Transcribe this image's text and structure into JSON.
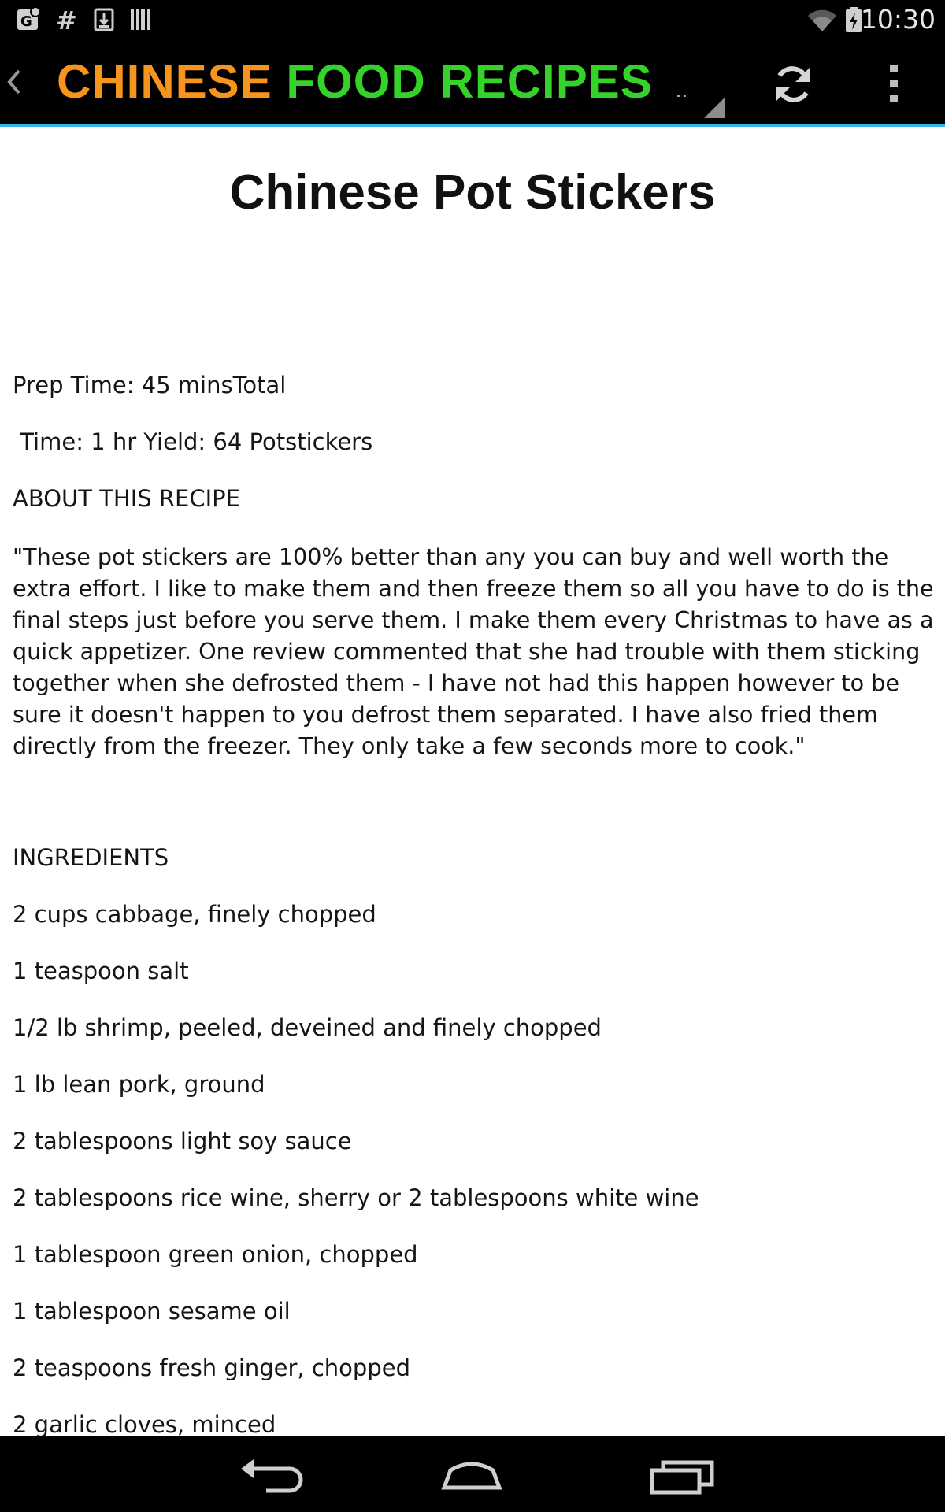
{
  "status_bar": {
    "time": "10:30",
    "icons": [
      "maps-notification-icon",
      "hashtag-notification-icon",
      "download-notification-icon",
      "barcode-notification-icon",
      "wifi-icon",
      "battery-charging-icon"
    ]
  },
  "action_bar": {
    "brand_word1": "CHINESE",
    "brand_word2": "FOOD RECIPES",
    "spinner_text": "..",
    "brand_colors": {
      "word1": "#f7941d",
      "word2": "#35d22a"
    },
    "accent": "#33b5e5",
    "icons": [
      "back-caret-icon",
      "refresh-icon",
      "overflow-menu-icon"
    ]
  },
  "recipe": {
    "title": "Chinese Pot Stickers",
    "meta_line1": "Prep Time: 45 minsTotal",
    "meta_line2": " Time: 1 hr Yield: 64 Potstickers",
    "about_heading": "ABOUT THIS RECIPE",
    "about_text": "\"These pot stickers are 100% better than any you can buy and well worth the extra effort. I like to make them and then freeze them so all you have to do is the final steps just before you serve them. I make them every Christmas to have as a quick appetizer. One review commented that she had trouble with them sticking together when she defrosted them - I have not had this happen however to be sure it doesn't happen to you defrost them separated. I have also fried them directly from the freezer. They only take a few seconds more to cook.\"",
    "ingredients_heading": "INGREDIENTS",
    "ingredients": [
      "2 cups cabbage, finely chopped",
      "1 teaspoon salt",
      "1/2 lb shrimp, peeled, deveined and finely chopped",
      "1 lb lean pork, ground",
      "2 tablespoons light soy sauce",
      "2 tablespoons rice wine, sherry or 2 tablespoons white wine",
      "1 tablespoon green onion, chopped",
      "1 tablespoon sesame oil",
      "2 teaspoons fresh ginger, chopped",
      "2 garlic cloves, minced"
    ]
  },
  "nav_bar": {
    "icons": [
      "back-nav-icon",
      "home-nav-icon",
      "recent-apps-icon"
    ]
  }
}
